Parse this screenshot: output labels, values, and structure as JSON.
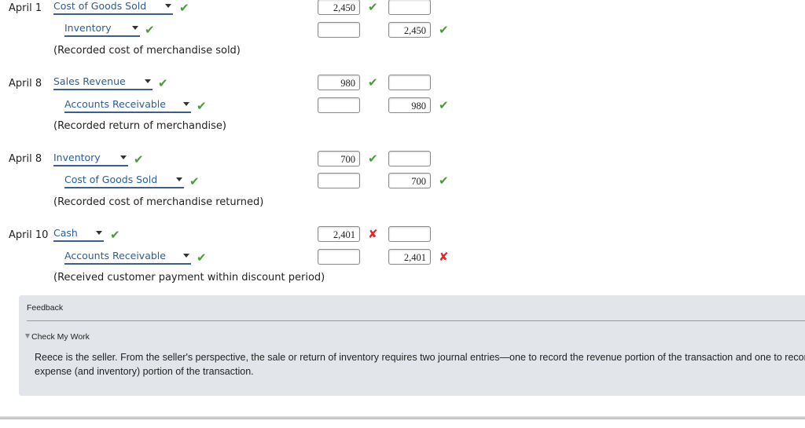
{
  "entries": [
    {
      "date": "April 1",
      "debit_account": "Cost of Goods Sold",
      "debit_account_status": "correct",
      "credit_account": "Inventory",
      "credit_account_status": "correct",
      "debit_amount": "2,450",
      "debit_status": "correct",
      "credit_amount": "2,450",
      "credit_status": "correct",
      "memo": "(Recorded cost of merchandise sold)"
    },
    {
      "date": "April 8",
      "debit_account": "Sales Revenue",
      "debit_account_status": "correct",
      "credit_account": "Accounts Receivable",
      "credit_account_status": "correct",
      "debit_amount": "980",
      "debit_status": "correct",
      "credit_amount": "980",
      "credit_status": "correct",
      "memo": "(Recorded return of merchandise)"
    },
    {
      "date": "April 8",
      "debit_account": "Inventory",
      "debit_account_status": "correct",
      "credit_account": "Cost of Goods Sold",
      "credit_account_status": "correct",
      "debit_amount": "700",
      "debit_status": "correct",
      "credit_amount": "700",
      "credit_status": "correct",
      "memo": "(Recorded cost of merchandise returned)"
    },
    {
      "date": "April 10",
      "debit_account": "Cash",
      "debit_account_status": "correct",
      "credit_account": "Accounts Receivable",
      "credit_account_status": "correct",
      "debit_amount": "2,401",
      "debit_status": "incorrect",
      "credit_amount": "2,401",
      "credit_status": "incorrect",
      "memo": "(Received customer payment within discount period)"
    }
  ],
  "icons": {
    "correct": "✔",
    "incorrect": "✘"
  },
  "feedback": {
    "title": "Feedback",
    "toggle_label": "Check My Work",
    "line1": "Reece is the seller. From the seller's perspective, the sale or return of inventory requires two journal entries—one to record the revenue portion of the transaction and one to record the",
    "line2": "expense (and inventory) portion of the transaction."
  },
  "colors": {
    "correct": "#4a9a3a",
    "incorrect": "#e02a2a",
    "link": "#2a5d98"
  }
}
